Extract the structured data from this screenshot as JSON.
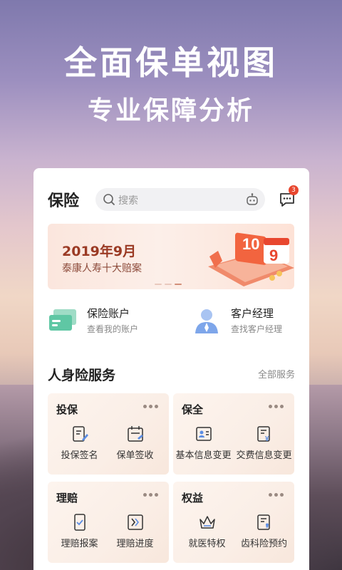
{
  "promo": {
    "headline": "全面保单视图",
    "subhead": "专业保障分析"
  },
  "app": {
    "title": "保险",
    "search_placeholder": "搜索",
    "message_badge": "3"
  },
  "banner": {
    "title": "2019年9月",
    "subtitle": "泰康人寿十大赔案",
    "art_numbers": [
      "10",
      "9"
    ]
  },
  "quick_links": [
    {
      "label": "保险账户",
      "desc": "查看我的账户"
    },
    {
      "label": "客户经理",
      "desc": "查找客户经理"
    }
  ],
  "section": {
    "title": "人身险服务",
    "more": "全部服务"
  },
  "tiles": [
    {
      "title": "投保",
      "services": [
        {
          "label": "投保签名",
          "icon": "sign-doc-icon"
        },
        {
          "label": "保单签收",
          "icon": "calendar-check-icon"
        }
      ]
    },
    {
      "title": "保全",
      "services": [
        {
          "label": "基本信息变更",
          "icon": "id-card-icon"
        },
        {
          "label": "交费信息变更",
          "icon": "payment-doc-icon"
        }
      ]
    },
    {
      "title": "理赔",
      "services": [
        {
          "label": "理赔报案",
          "icon": "phone-check-icon"
        },
        {
          "label": "理赔进度",
          "icon": "progress-icon"
        }
      ]
    },
    {
      "title": "权益",
      "services": [
        {
          "label": "就医特权",
          "icon": "crown-icon"
        },
        {
          "label": "齿科险预约",
          "icon": "tooth-doc-icon"
        }
      ]
    }
  ],
  "colors": {
    "accent": "#e9a284",
    "badge": "#e8472f",
    "banner_text": "#9b3a24"
  }
}
